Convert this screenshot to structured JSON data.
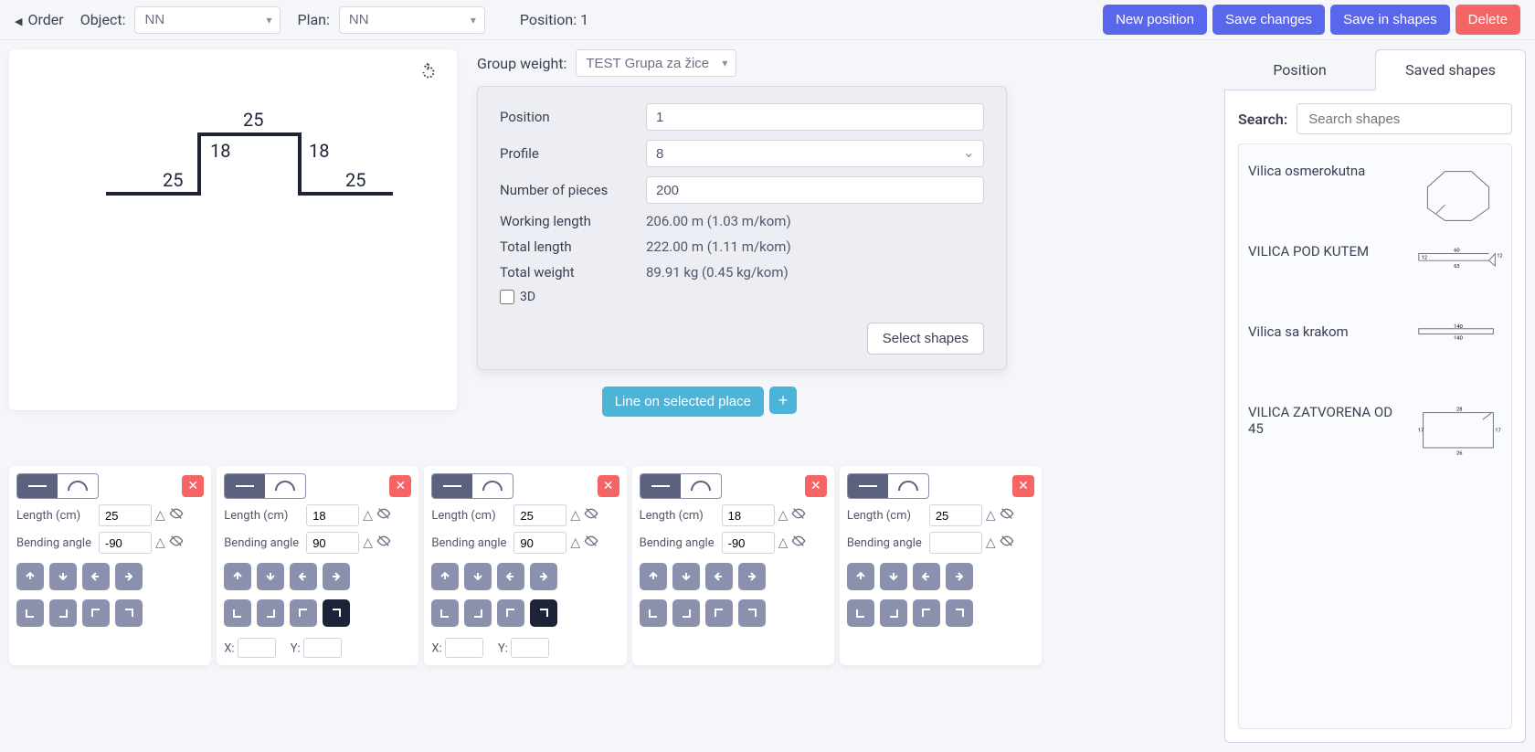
{
  "topbar": {
    "order_label": "Order",
    "object_label": "Object:",
    "object_value": "NN",
    "plan_label": "Plan:",
    "plan_value": "NN",
    "position_label": "Position: 1",
    "buttons": {
      "new_position": "New position",
      "save_changes": "Save changes",
      "save_in_shapes": "Save in shapes",
      "delete": "Delete"
    }
  },
  "preview": {
    "dims": {
      "a": "25",
      "b": "18",
      "c": "25",
      "d": "18",
      "e": "25"
    }
  },
  "group_weight": {
    "label": "Group weight:",
    "value": "TEST Grupa za žice"
  },
  "form": {
    "position": {
      "label": "Position",
      "value": "1"
    },
    "profile": {
      "label": "Profile",
      "value": "8"
    },
    "pieces": {
      "label": "Number of pieces",
      "value": "200"
    },
    "working_length": {
      "label": "Working length",
      "value": "206.00 m (1.03 m/kom)"
    },
    "total_length": {
      "label": "Total length",
      "value": "222.00 m (1.11 m/kom)"
    },
    "total_weight": {
      "label": "Total weight",
      "value": "89.91 kg (0.45 kg/kom)"
    },
    "threeD": "3D",
    "select_shapes": "Select shapes"
  },
  "line_action": {
    "label": "Line on selected place"
  },
  "segments": {
    "length_label": "Length (cm)",
    "angle_label": "Bending angle",
    "x_label": "X:",
    "y_label": "Y:",
    "items": [
      {
        "length": "25",
        "angle": "-90",
        "pill": "line",
        "corner_dark": null,
        "show_xy": false
      },
      {
        "length": "18",
        "angle": "90",
        "pill": "line",
        "corner_dark": "tr",
        "show_xy": true
      },
      {
        "length": "25",
        "angle": "90",
        "pill": "line",
        "corner_dark": "tr",
        "show_xy": true
      },
      {
        "length": "18",
        "angle": "-90",
        "pill": "line",
        "corner_dark": null,
        "show_xy": false
      },
      {
        "length": "25",
        "angle": "",
        "pill": "line",
        "corner_dark": null,
        "show_xy": false
      }
    ]
  },
  "tabs": {
    "position": "Position",
    "saved": "Saved shapes"
  },
  "search": {
    "label": "Search:",
    "placeholder": "Search shapes"
  },
  "shapes": [
    {
      "name": "Vilica osmerokutna"
    },
    {
      "name": "VILICA POD KUTEM"
    },
    {
      "name": "Vilica sa krakom"
    },
    {
      "name": "VILICA ZATVORENA OD 45"
    }
  ]
}
